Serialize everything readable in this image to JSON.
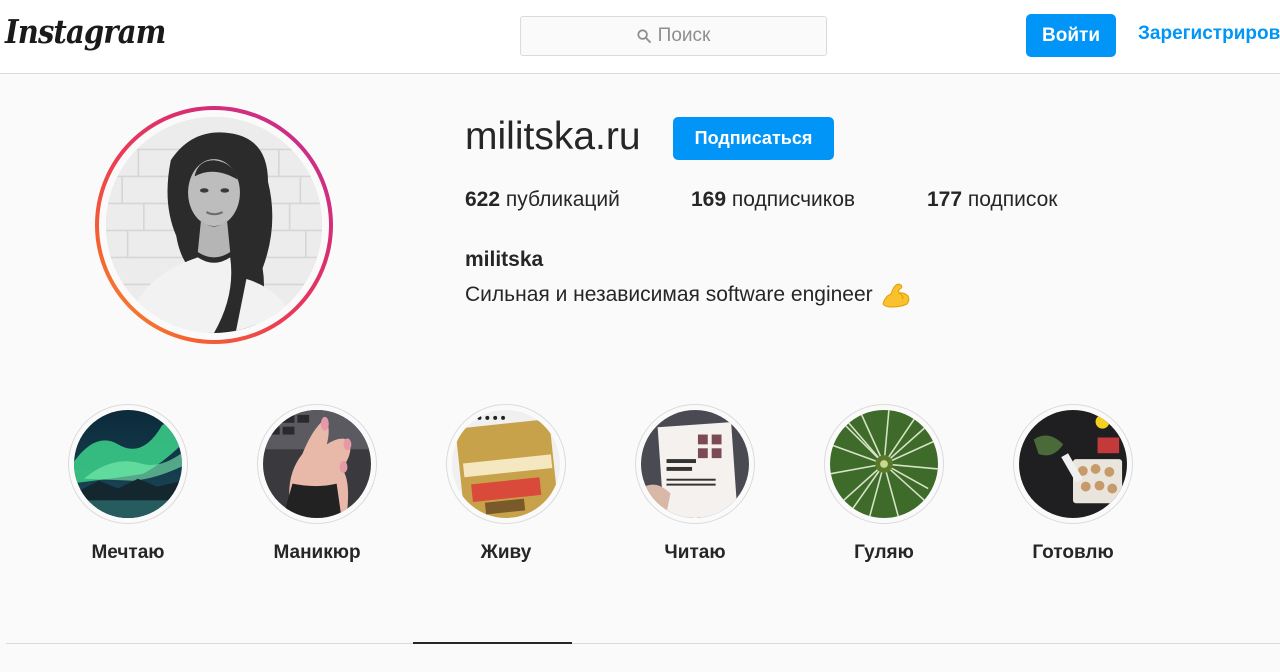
{
  "nav": {
    "logo_text": "Instagram",
    "search_placeholder": "Поиск",
    "search_icon": "magnifier-icon",
    "login_label": "Войти",
    "signup_label": "Зарегистрироваться"
  },
  "profile": {
    "username": "militska.ru",
    "follow_label": "Подписаться",
    "stats": {
      "posts_count": "622",
      "posts_label": "публикаций",
      "followers_count": "169",
      "followers_label": "подписчиков",
      "following_count": "177",
      "following_label": "подписок"
    },
    "full_name": "militska",
    "bio_text": "Сильная и независимая software engineer",
    "bio_emoji": "flexed-biceps-icon"
  },
  "highlights": [
    {
      "label": "Мечтаю"
    },
    {
      "label": "Маникюр"
    },
    {
      "label": "Живу"
    },
    {
      "label": "Читаю"
    },
    {
      "label": "Гуляю"
    },
    {
      "label": "Готовлю"
    }
  ],
  "colors": {
    "accent": "#0095f6",
    "text": "#262626",
    "muted": "#8e8e8e",
    "background": "#fafafa",
    "border": "#dbdbdb",
    "story_ring_start": "#c02f9d",
    "story_ring_end": "#f9a53a"
  }
}
